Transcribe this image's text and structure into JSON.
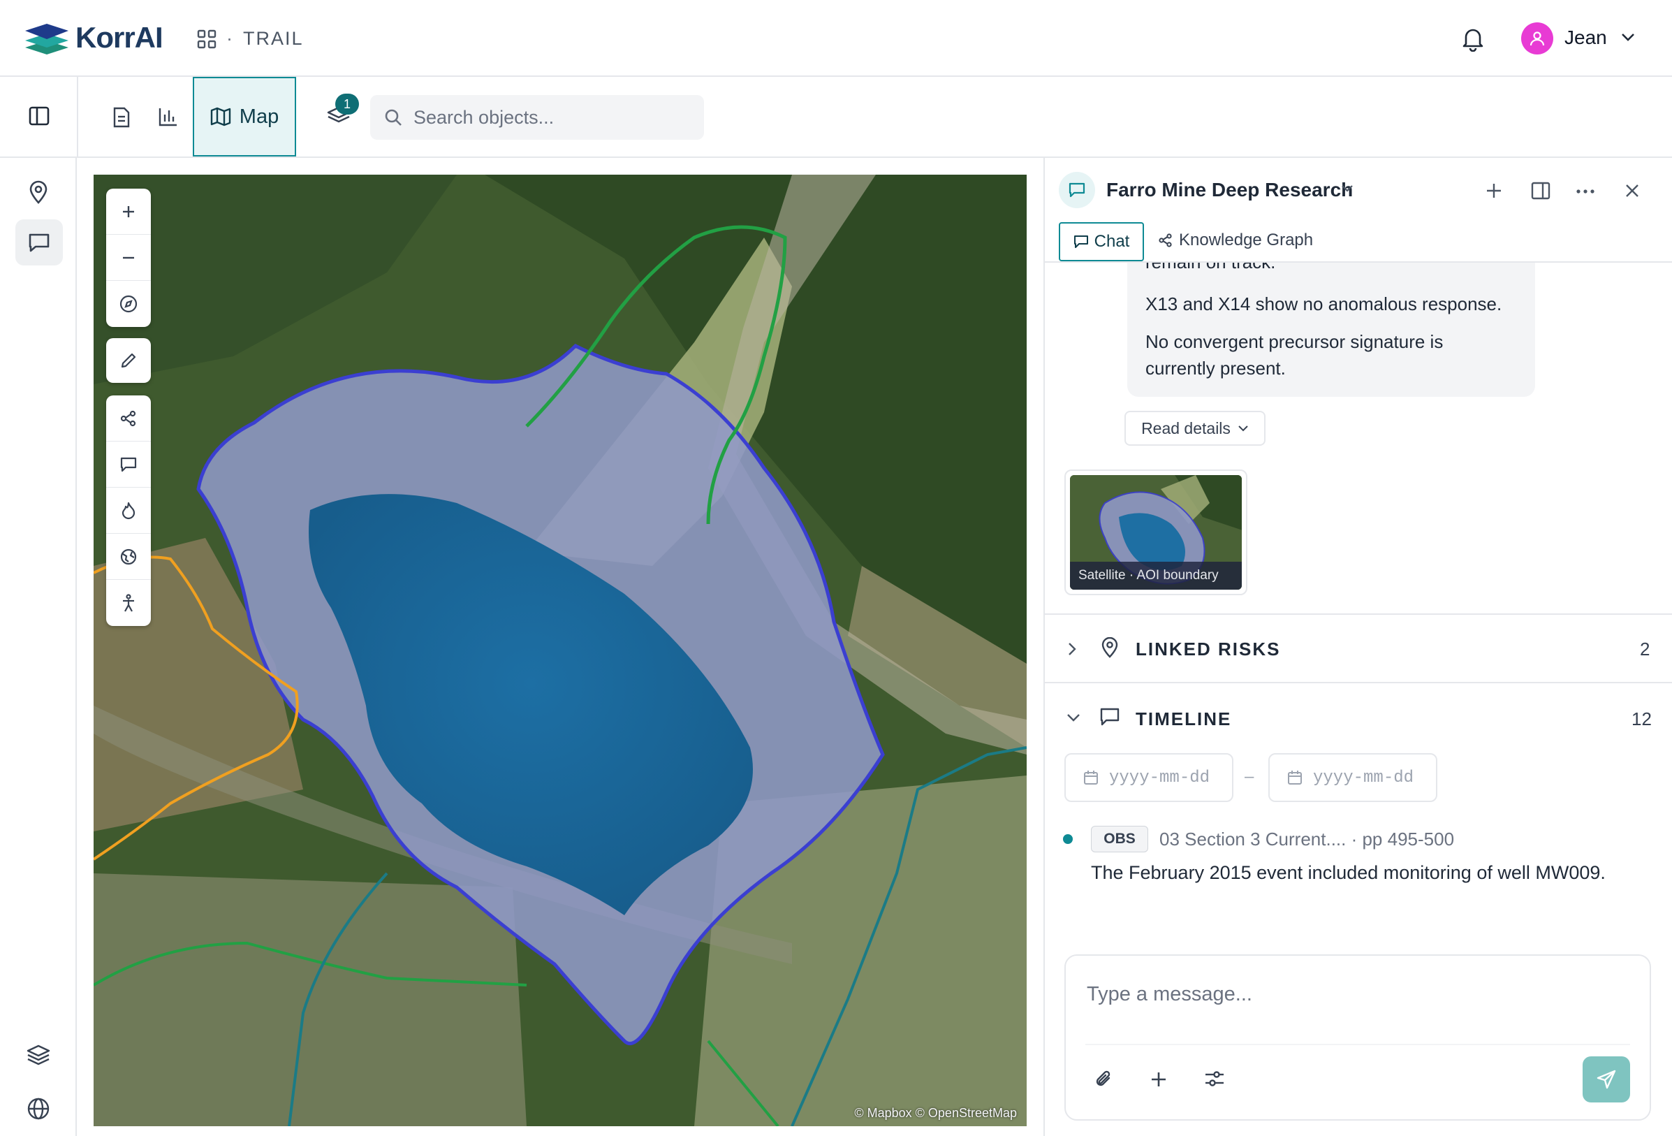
{
  "brand": {
    "name": "KorrAI",
    "logo_icon": "layers-logo-icon"
  },
  "header": {
    "workspace_separator": "·",
    "workspace": "TRAIL",
    "user": "Jean"
  },
  "toolbar": {
    "map_tab_label": "Map",
    "layer_badge_count": "1",
    "search_placeholder": "Search objects..."
  },
  "map": {
    "attribution": "© Mapbox © OpenStreetMap",
    "controls": [
      "zoom-in",
      "zoom-out",
      "compass",
      "draw",
      "share",
      "comment",
      "fire",
      "globe",
      "person"
    ],
    "colors": {
      "aoi": "#3b3fd1",
      "water": "#1e6fa3",
      "zone_green": "#22a044",
      "zone_orange": "#f0a020",
      "zone_teal": "#1b7b86"
    }
  },
  "panel": {
    "title": "Farro Mine Deep Research",
    "tabs": {
      "chat": "Chat",
      "knowledge_graph": "Knowledge Graph"
    },
    "message": {
      "line_partial": "remain on track.",
      "line_1": "X13 and X14 show no anomalous response.",
      "line_2a": "No convergent precursor signature is",
      "line_2b": "currently present."
    },
    "read_details": "Read details",
    "thumbnail_caption": "Satellite · AOI boundary",
    "linked_risks": {
      "title": "LINKED RISKS",
      "count": "2"
    },
    "timeline": {
      "title": "TIMELINE",
      "count": "12",
      "date_from_placeholder": "yyyy-mm-dd",
      "date_separator": "–",
      "date_to_placeholder": "yyyy-mm-dd",
      "event": {
        "badge": "OBS",
        "source": "03 Section 3 Current.... · pp 495-500",
        "text": "The February 2015 event included monitoring of well MW009."
      }
    },
    "composer": {
      "placeholder": "Type a message..."
    }
  },
  "accent_color": "#0e8a94"
}
